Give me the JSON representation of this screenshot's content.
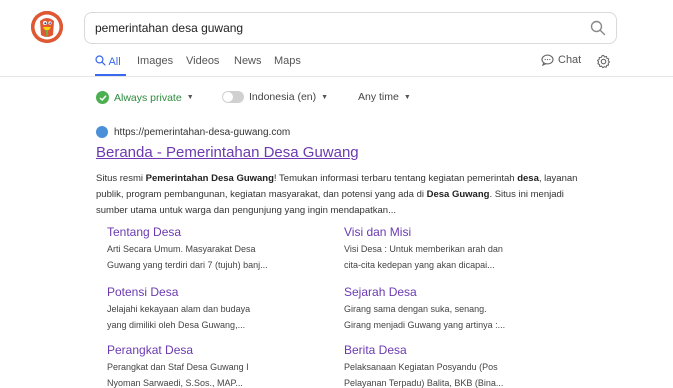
{
  "search": {
    "query": "pemerintahan desa guwang"
  },
  "tabs": [
    {
      "label": "All"
    },
    {
      "label": "Images"
    },
    {
      "label": "Videos"
    },
    {
      "label": "News"
    },
    {
      "label": "Maps"
    }
  ],
  "chat_label": "Chat",
  "filters": {
    "private": "Always private",
    "region": "Indonesia (en)",
    "time": "Any time"
  },
  "result": {
    "url": "https://pemerintahan-desa-guwang.com",
    "title": "Beranda - Pemerintahan Desa Guwang",
    "snippet": {
      "p1": "Situs resmi ",
      "b1": "Pemerintahan Desa Guwang",
      "p2": "! Temukan informasi terbaru tentang kegiatan pemerintah ",
      "b2": "desa",
      "p3": ", layanan publik, program pembangunan, kegiatan masyarakat, dan potensi yang ada di ",
      "b3": "Desa Guwang",
      "p4": ". Situs ini menjadi sumber utama untuk warga dan pengunjung yang ingin mendapatkan..."
    }
  },
  "sitelinks": [
    {
      "title": "Tentang Desa",
      "desc1": "Arti Secara Umum. Masyarakat Desa",
      "desc2": "Guwang yang terdiri dari 7 (tujuh) banj..."
    },
    {
      "title": "Visi dan Misi",
      "desc1": "Visi Desa : Untuk memberikan arah dan",
      "desc2": "cita-cita kedepan yang akan dicapai..."
    },
    {
      "title": "Potensi Desa",
      "desc1": "Jelajahi kekayaan alam dan budaya",
      "desc2": "yang dimiliki oleh Desa Guwang,..."
    },
    {
      "title": "Sejarah Desa",
      "desc1": "Girang sama dengan suka, senang.",
      "desc2": "Girang menjadi Guwang yang artinya :..."
    },
    {
      "title": "Perangkat Desa",
      "desc1": "Perangkat dan Staf Desa Guwang I",
      "desc2": "Nyoman Sarwaedi, S.Sos., MAP..."
    },
    {
      "title": "Berita Desa",
      "desc1": "Pelaksanaan Kegiatan Posyandu (Pos",
      "desc2": "Pelayanan Terpadu) Balita, BKB (Bina..."
    }
  ]
}
